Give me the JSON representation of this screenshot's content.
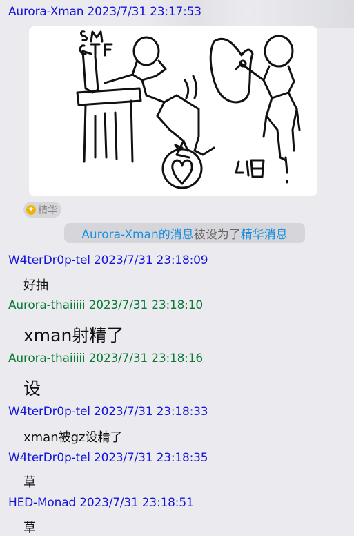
{
  "messages": [
    {
      "sender": "Aurora-Xman",
      "time": "2023/7/31 23:17:53",
      "color": "blue"
    },
    {
      "sender": "W4terDr0p-tel",
      "time": "2023/7/31 23:18:09",
      "text": "好抽",
      "color": "blue"
    },
    {
      "sender": "Aurora-thaiiiii",
      "time": "2023/7/31 23:18:10",
      "text": "xman射精了",
      "color": "green"
    },
    {
      "sender": "Aurora-thaiiiii",
      "time": "2023/7/31 23:18:16",
      "text": "设",
      "color": "green"
    },
    {
      "sender": "W4terDr0p-tel",
      "time": "2023/7/31 23:18:33",
      "text": "xman被gz设精了",
      "color": "blue"
    },
    {
      "sender": "W4terDr0p-tel",
      "time": "2023/7/31 23:18:35",
      "text": "草",
      "color": "blue"
    },
    {
      "sender": "HED-Monad",
      "time": "2023/7/31 23:18:51",
      "text": "草",
      "color": "blue"
    }
  ],
  "drawing": {
    "text_top": "sM CTF",
    "text_exclaim": "啪!"
  },
  "badge": {
    "label": "精华",
    "icon": "star-icon"
  },
  "notice": {
    "link1": "Aurora-Xman的消息",
    "middle": "被设为了",
    "link2": "精华消息"
  },
  "colors": {
    "sender_blue": "#1414d8",
    "sender_green": "#0a7a35",
    "link": "#1a8fe0",
    "background": "#ebebef"
  }
}
